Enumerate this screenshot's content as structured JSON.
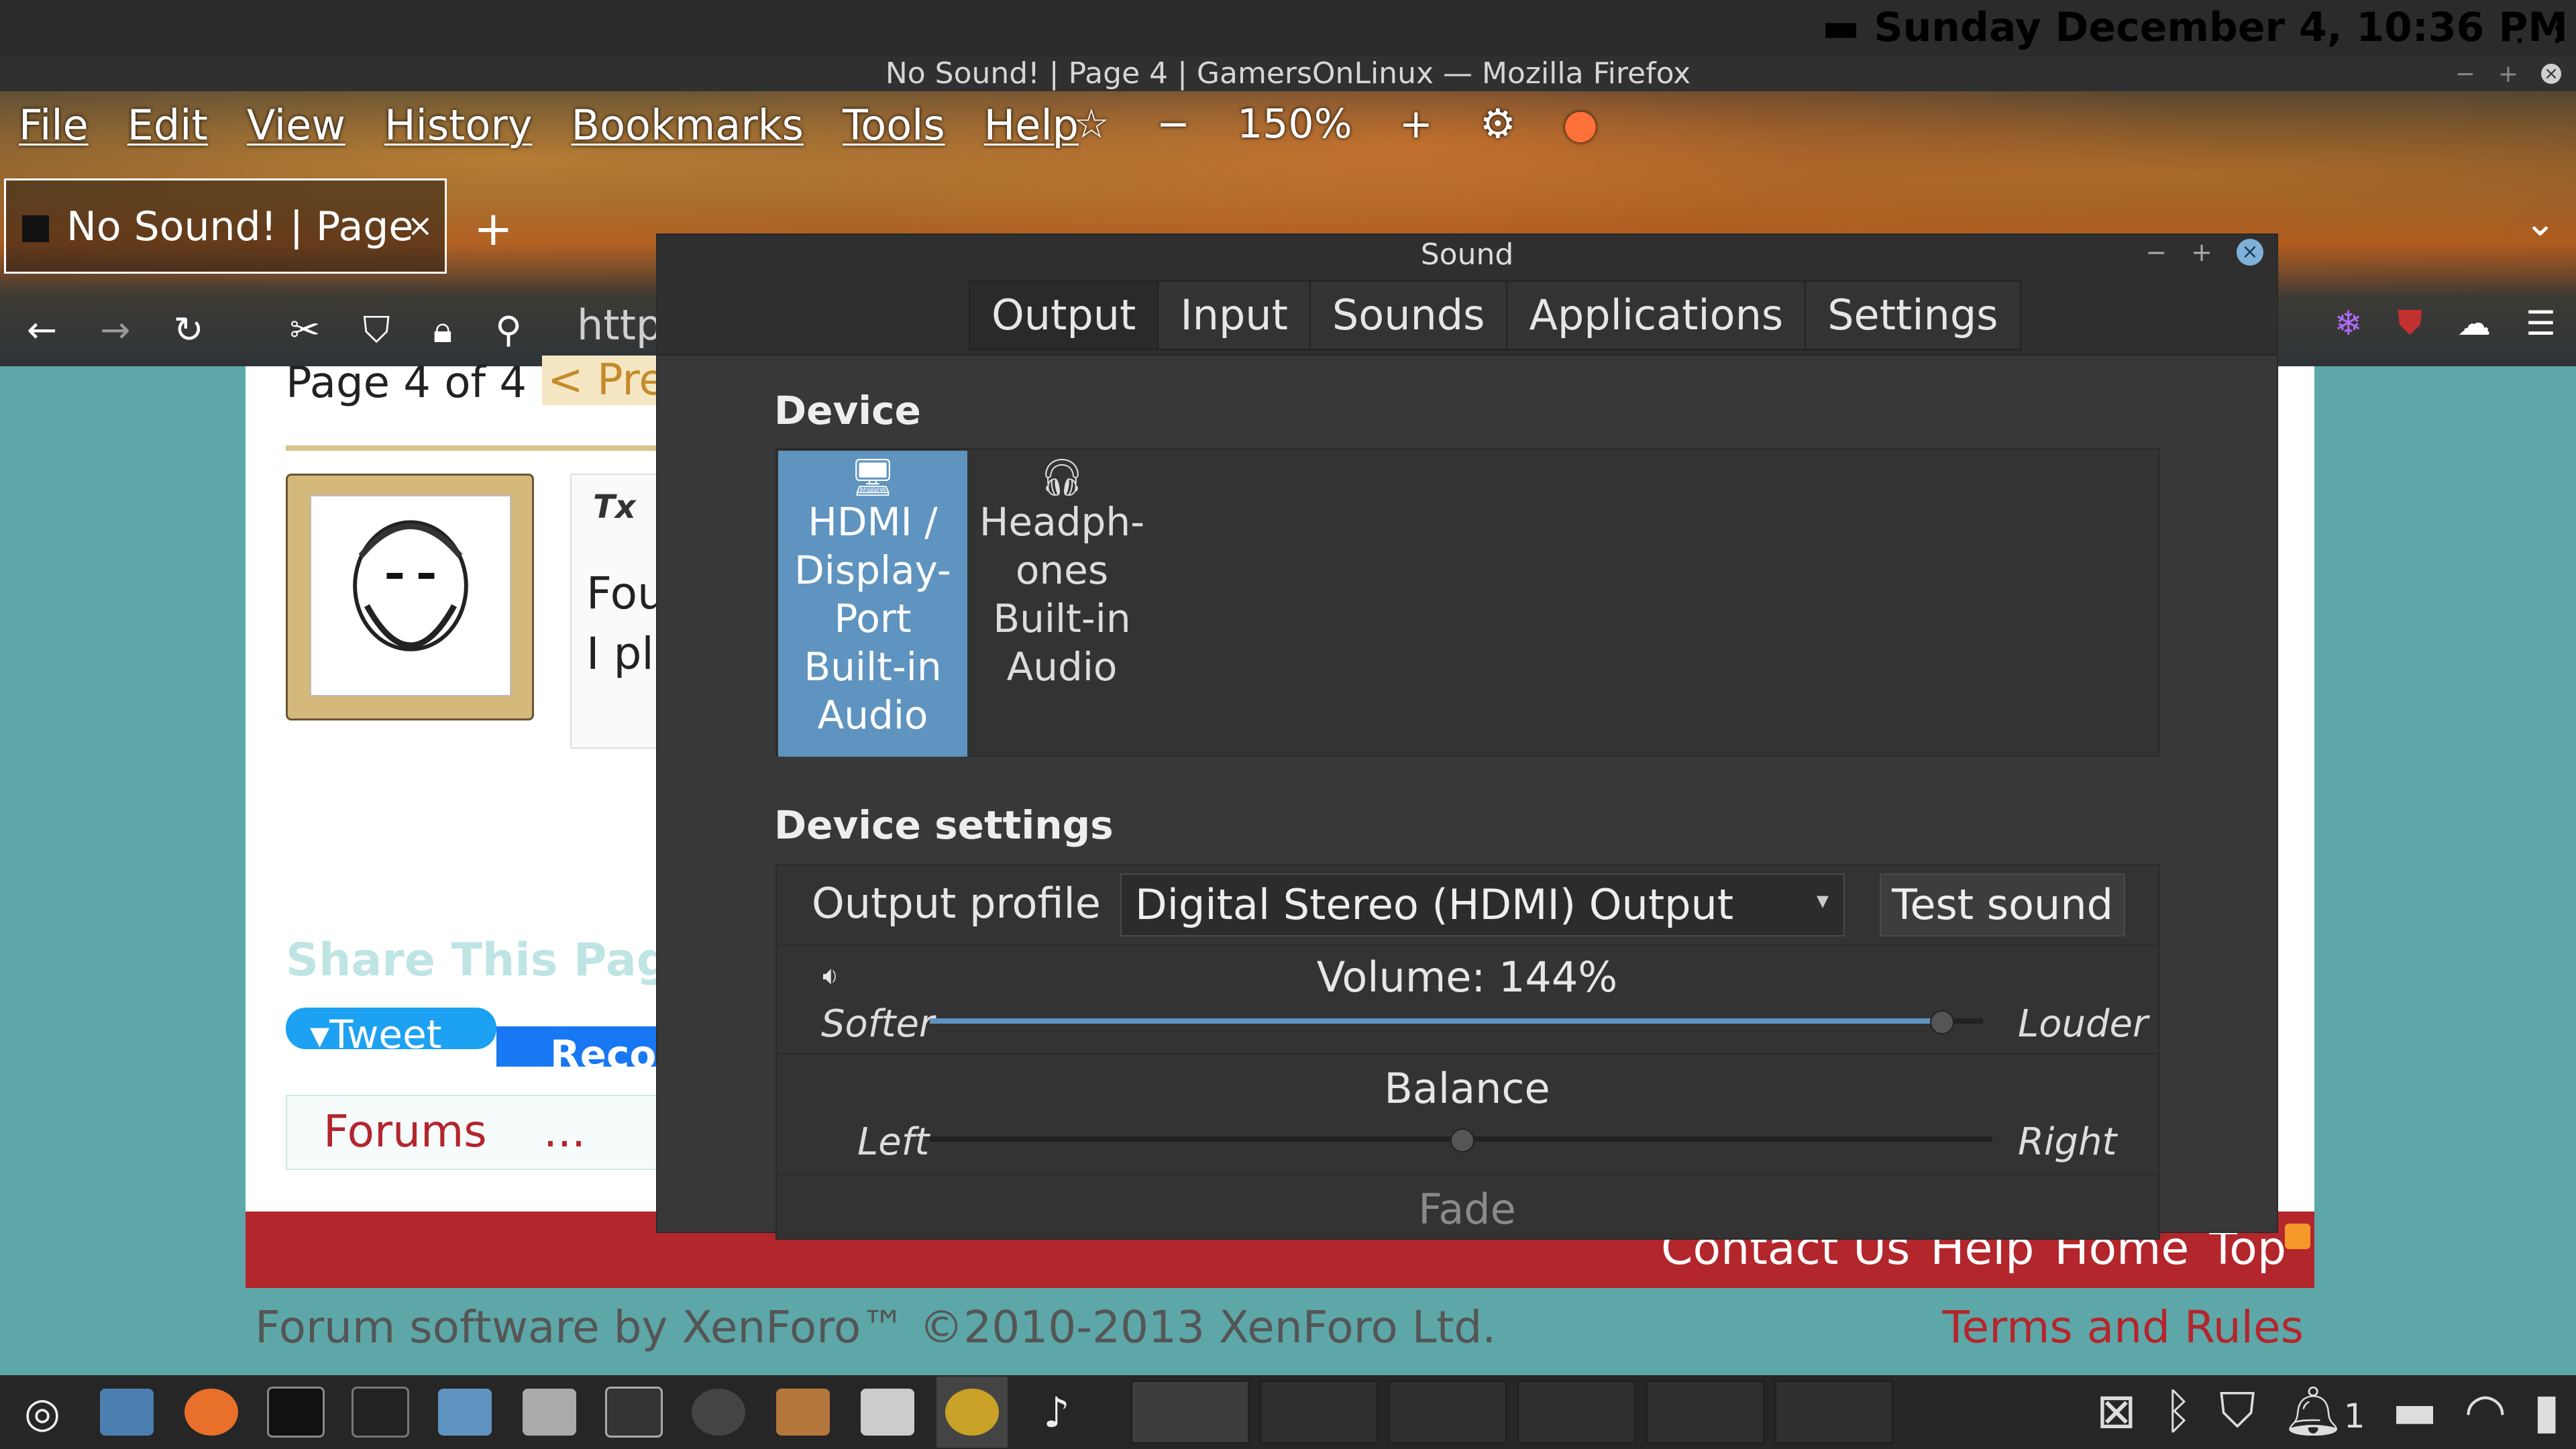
{
  "system": {
    "clock": "Sunday December  4, 10:36 PM",
    "icons": [
      "apps-grid-icon",
      "keyboard-icon"
    ]
  },
  "firefox": {
    "window_title": "No Sound! | Page 4 | GamersOnLinux — Mozilla Firefox",
    "menu": [
      "File",
      "Edit",
      "View",
      "History",
      "Bookmarks",
      "Tools",
      "Help"
    ],
    "zoom": "150%",
    "tab_title": "No Sound! | Page",
    "url_fragment": "http"
  },
  "webpage": {
    "page_info": "Page 4 of 4",
    "prev": "< Pre",
    "post_text_1": "Fou",
    "post_text_2": "I pl",
    "share_title": "Share This Pag",
    "tweet": "Tweet",
    "recommend": "Reco",
    "breadcrumb": [
      "Forums",
      "..."
    ],
    "footer_links": [
      "Contact Us",
      "Help",
      "Home",
      "Top"
    ],
    "copyright": "Forum software by XenForo™ ©2010-2013 XenForo Ltd.",
    "terms": "Terms and Rules"
  },
  "sound_dialog": {
    "title": "Sound",
    "tabs": [
      "Output",
      "Input",
      "Sounds",
      "Applications",
      "Settings"
    ],
    "active_tab": "Output",
    "device_heading": "Device",
    "devices": [
      {
        "name": "HDMI / Display-Port Built-in Audio",
        "lines": [
          "HDMI /",
          "Display-",
          "Port",
          "Built-in",
          "Audio"
        ],
        "icon": "monitor-icon",
        "selected": true
      },
      {
        "name": "Headphones Built-in Audio",
        "lines": [
          "Headph-",
          "ones",
          "Built-in",
          "Audio"
        ],
        "icon": "headphones-icon",
        "selected": false
      }
    ],
    "device_settings_heading": "Device settings",
    "output_profile_label": "Output profile",
    "output_profile_value": "Digital Stereo (HDMI) Output",
    "test_sound": "Test sound",
    "volume_label": "Volume: 144%",
    "volume_percent": 144,
    "volume_max_percent": 150,
    "softer": "Softer",
    "louder": "Louder",
    "balance_label": "Balance",
    "balance_value": 0,
    "left": "Left",
    "right": "Right",
    "fade_label": "Fade"
  },
  "taskbar": {
    "apps": [
      "mint-menu-icon",
      "desktop-icon",
      "firefox-icon",
      "terminal-icon",
      "terminal-icon",
      "files-icon",
      "settings-icon",
      "screenshot-icon",
      "webcam-icon",
      "speaker-icon",
      "mixer-icon",
      "audio-icon",
      "music-note-icon"
    ],
    "notification_count": "1",
    "colors": {
      "accent": "#5e94bf",
      "footer": "#b3262c",
      "link": "#b3262c"
    }
  }
}
